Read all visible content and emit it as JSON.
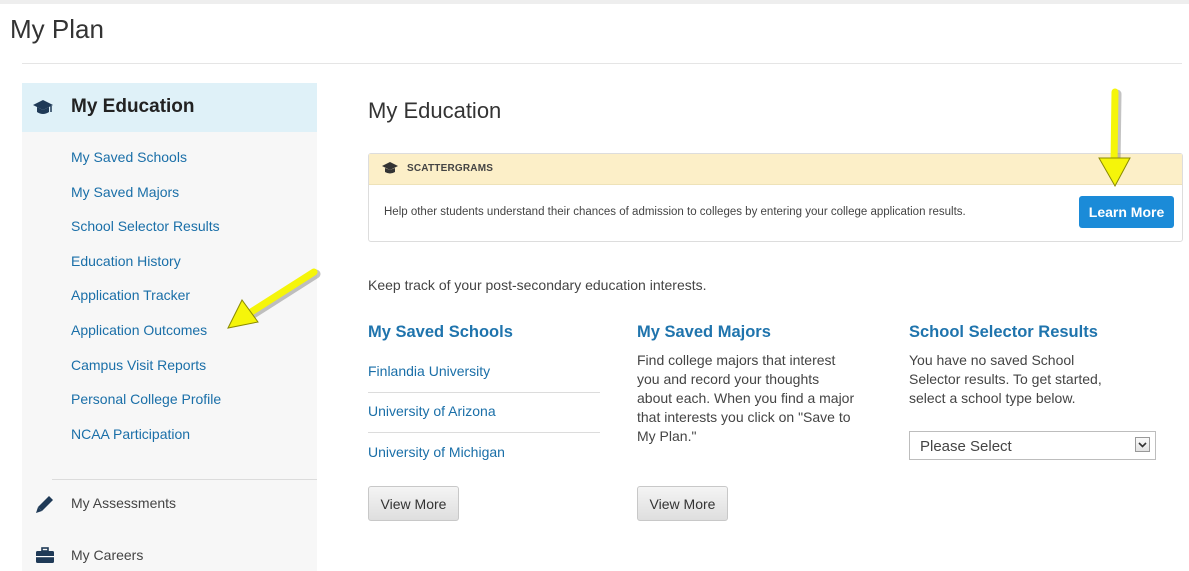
{
  "page": {
    "title": "My Plan"
  },
  "sidebar": {
    "header": {
      "label": "My Education",
      "icon": "graduation-cap-icon"
    },
    "links": [
      "My Saved Schools",
      "My Saved Majors",
      "School Selector Results",
      "Education History",
      "Application Tracker",
      "Application Outcomes",
      "Campus Visit Reports",
      "Personal College Profile",
      "NCAA Participation"
    ],
    "items": [
      {
        "label": "My Assessments",
        "icon": "pencil-icon"
      },
      {
        "label": "My Careers",
        "icon": "briefcase-icon"
      }
    ]
  },
  "main": {
    "title": "My Education",
    "scattergrams": {
      "heading": "SCATTERGRAMS",
      "icon": "graduation-cap-icon",
      "body": "Help other students understand their chances of admission to colleges by entering your college application results.",
      "button": "Learn More"
    },
    "intro": "Keep track of your post-secondary education interests.",
    "saved_schools": {
      "heading": "My Saved Schools",
      "schools": [
        "Finlandia University",
        "University of Arizona",
        "University of Michigan"
      ],
      "button": "View More"
    },
    "saved_majors": {
      "heading": "My Saved Majors",
      "lines": [
        "Find college majors that interest",
        "you and record your thoughts",
        "about each. When you find a major",
        "that interests you click on \"Save to",
        "My Plan.\""
      ],
      "button": "View More"
    },
    "school_selector": {
      "heading": "School Selector Results",
      "lines": [
        "You have no saved School",
        "Selector results. To get started,",
        "select a school type below."
      ],
      "select_value": "Please Select"
    }
  },
  "colors": {
    "link": "#1a6fa8",
    "heading": "#1f74ad",
    "accent_button": "#1b8bd8",
    "annotation_arrow": "#f5f50a"
  }
}
